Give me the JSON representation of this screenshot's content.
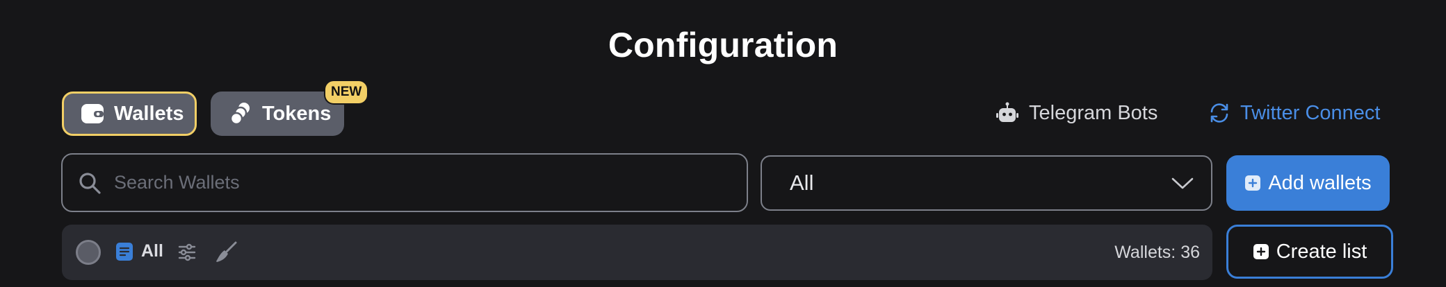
{
  "page": {
    "title": "Configuration"
  },
  "tabs": [
    {
      "label": "Wallets",
      "icon": "wallet-icon",
      "active": true
    },
    {
      "label": "Tokens",
      "icon": "coins-icon",
      "badge": "NEW"
    }
  ],
  "links": {
    "telegram": {
      "label": "Telegram Bots",
      "icon": "robot-icon"
    },
    "twitter": {
      "label": "Twitter Connect",
      "icon": "refresh-icon"
    }
  },
  "search": {
    "placeholder": "Search Wallets",
    "value": ""
  },
  "filter_select": {
    "value": "All"
  },
  "actions": {
    "add_wallets": "Add wallets",
    "create_list": "Create list"
  },
  "list_bar": {
    "list_label": "All",
    "wallet_count": "Wallets: 36"
  },
  "colors": {
    "background": "#161618",
    "accent_blue": "#3a7fd8",
    "accent_yellow": "#f2cf66",
    "tab_bg": "#5b5e69",
    "bar_bg": "#2a2b31",
    "link_blue": "#4a8ee6"
  }
}
